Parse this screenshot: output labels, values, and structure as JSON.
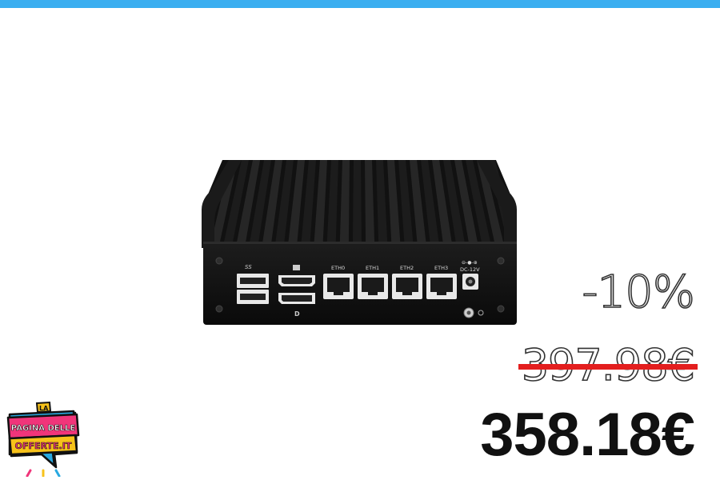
{
  "product": {
    "ports": {
      "usb_label": "SS",
      "eth_labels": [
        "ETH0",
        "ETH1",
        "ETH2",
        "ETH3"
      ],
      "power_label": "DC-12V",
      "dp_label": "D"
    }
  },
  "pricing": {
    "discount": "-10%",
    "old_price": "397.98€",
    "new_price": "358.18€"
  },
  "logo": {
    "line1": "LA",
    "line2": "PAGINA DELLE",
    "line3": "OFFERTE.IT"
  },
  "colors": {
    "top_bar": "#3aaef0",
    "strike": "#e31e1e",
    "logo_pink": "#f0357a",
    "logo_blue": "#29a9e1",
    "logo_yellow": "#f7c21b"
  }
}
